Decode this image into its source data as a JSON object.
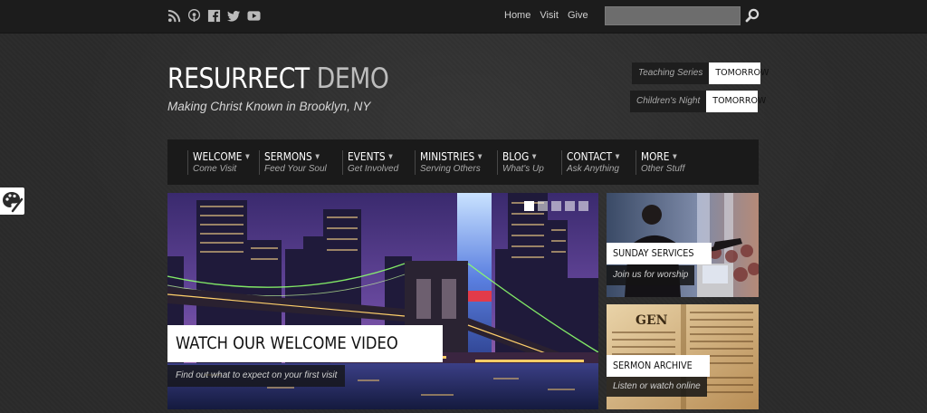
{
  "topbar": {
    "social_icons": [
      "rss-icon",
      "podcast-icon",
      "facebook-icon",
      "twitter-icon",
      "youtube-icon"
    ],
    "links": [
      "Home",
      "Visit",
      "Give"
    ],
    "search": {
      "value": "",
      "placeholder": ""
    }
  },
  "logo": {
    "part1": "RESURRECT",
    "part2": "DEMO"
  },
  "tagline": "Making Christ Known in Brooklyn, NY",
  "events": [
    {
      "label": "Teaching Series",
      "when": "TOMORROW"
    },
    {
      "label": "Children's Night",
      "when": "TOMORROW"
    }
  ],
  "nav": [
    {
      "title": "WELCOME",
      "subtitle": "Come Visit"
    },
    {
      "title": "SERMONS",
      "subtitle": "Feed Your Soul"
    },
    {
      "title": "EVENTS",
      "subtitle": "Get Involved"
    },
    {
      "title": "MINISTRIES",
      "subtitle": "Serving Others"
    },
    {
      "title": "BLOG",
      "subtitle": "What's Up"
    },
    {
      "title": "CONTACT",
      "subtitle": "Ask Anything"
    },
    {
      "title": "MORE",
      "subtitle": "Other Stuff"
    }
  ],
  "slider": {
    "title": "WATCH OUR WELCOME VIDEO",
    "subtitle": "Find out what to expect on your first visit",
    "slide_count": 5,
    "active_slide": 1
  },
  "boxes": [
    {
      "title": "SUNDAY SERVICES",
      "subtitle": "Join us for worship"
    },
    {
      "title": "SERMON ARCHIVE",
      "subtitle": "Listen or watch online"
    }
  ],
  "book_text": "GEN"
}
